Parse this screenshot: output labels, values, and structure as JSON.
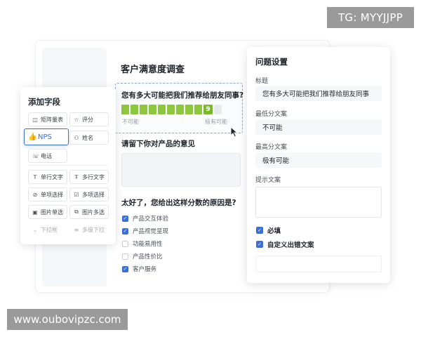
{
  "watermarks": {
    "top_right": "TG: MYYJJPP",
    "bottom_left": "www.oubovipzc.com"
  },
  "survey": {
    "title": "客户满意度调查",
    "nps_question": "您有多大可能把我们推荐给朋友同事?",
    "nps_selected": "9",
    "nps_low_label": "不可能",
    "nps_high_label": "极有可能",
    "feedback_question": "请留下你对产品的意见",
    "reason_question": "太好了，您给出这样分数的原因是?",
    "reasons": [
      {
        "label": "产品交互体验",
        "checked": true
      },
      {
        "label": "产品视觉呈现",
        "checked": true
      },
      {
        "label": "功能易用性",
        "checked": false
      },
      {
        "label": "产品性价比",
        "checked": false
      },
      {
        "label": "客户服务",
        "checked": true
      }
    ]
  },
  "add_fields": {
    "title": "添加字段",
    "items": [
      {
        "label": "矩阵量表",
        "icon": "matrix-icon"
      },
      {
        "label": "评分",
        "icon": "star-icon"
      },
      {
        "label": "NPS",
        "icon": "thumbs-up-icon"
      },
      {
        "label": "姓名",
        "icon": "person-icon"
      },
      {
        "label": "电话",
        "icon": "phone-icon"
      },
      {
        "label": "单行文字",
        "icon": "text-icon"
      },
      {
        "label": "多行文字",
        "icon": "multiline-text-icon"
      },
      {
        "label": "单项选择",
        "icon": "radio-check-icon"
      },
      {
        "label": "多项选择",
        "icon": "checkbox-icon"
      },
      {
        "label": "图片单选",
        "icon": "image-icon"
      },
      {
        "label": "图片多选",
        "icon": "images-icon"
      },
      {
        "label": "下拉框",
        "icon": "chevron-down-icon"
      },
      {
        "label": "多级下拉",
        "icon": "cascade-icon"
      }
    ]
  },
  "settings": {
    "title": "问题设置",
    "title_label": "标题",
    "title_value": "您有多大可能把我们推荐给朋友同事",
    "min_label": "最低分文案",
    "min_value": "不可能",
    "max_label": "最高分文案",
    "max_value": "极有可能",
    "hint_label": "提示文案",
    "required_label": "必填",
    "required_checked": true,
    "custom_error_label": "自定义出错文案",
    "custom_error_checked": true
  },
  "colors": {
    "accent": "#3b6fd4",
    "nps_green": "#8dc63f",
    "watermark_bg": "#9a9a9a"
  }
}
